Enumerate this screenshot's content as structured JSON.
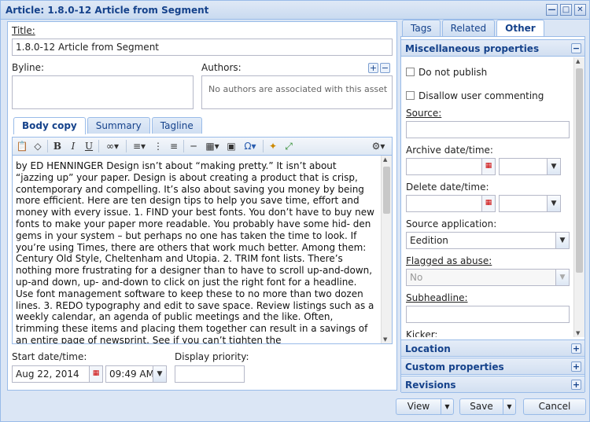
{
  "window": {
    "title": "Article: 1.8.0-12 Article from Segment"
  },
  "left": {
    "title_label": "Title:",
    "title_value": "1.8.0-12 Article from Segment",
    "byline_label": "Byline:",
    "byline_value": "",
    "authors_label": "Authors:",
    "authors_empty": "No authors are associated with this asset",
    "tabs": [
      {
        "label": "Body copy"
      },
      {
        "label": "Summary"
      },
      {
        "label": "Tagline"
      }
    ],
    "body_text": "by ED HENNINGER Design isn’t about “making pretty.” It isn’t about “jazzing up” your paper. Design is about creating a product that is crisp, contemporary and compelling. It’s also about saving you money by being more efficient. Here are ten design tips to help you save time, effort and money with every issue. 1. FIND your best fonts. You don’t have to buy new fonts to make your paper more readable. You probably have some hid- den gems in your system – but perhaps no one has taken the time to look. If you’re using Times, there are others that work much better. Among them: Century Old Style, Cheltenham and Utopia. 2. TRIM font lists. There’s nothing more frustrating for a designer than to have to scroll up-and-down, up-and down, up- and-down to click on just the right font for a headline. Use font management software to keep these to no more than two dozen lines. 3. REDO typography and edit to save space. Review listings such as a weekly calendar, an agenda of public meetings and the like. Often, trimming these items and placing them together can result in a savings of an entire page of newsprint. See if you can’t tighten the",
    "start_label": "Start date/time:",
    "start_date": "Aug 22, 2014",
    "start_time": "09:49 AM",
    "priority_label": "Display priority:",
    "priority_value": ""
  },
  "right": {
    "tabs": [
      {
        "label": "Tags"
      },
      {
        "label": "Related"
      },
      {
        "label": "Other"
      }
    ],
    "misc_header": "Miscellaneous properties",
    "do_not_publish": "Do not publish",
    "disallow_commenting": "Disallow user commenting",
    "source_label": "Source:",
    "source_value": "",
    "archive_label": "Archive date/time:",
    "delete_label": "Delete date/time:",
    "source_app_label": "Source application:",
    "source_app_value": "Eedition",
    "flagged_label": "Flagged as abuse:",
    "flagged_value": "No",
    "subheadline_label": "Subheadline:",
    "kicker_label": "Kicker:",
    "sections": [
      {
        "label": "Location"
      },
      {
        "label": "Custom properties"
      },
      {
        "label": "Revisions"
      }
    ]
  },
  "buttons": {
    "view": "View",
    "save": "Save",
    "cancel": "Cancel"
  },
  "icons": {
    "minimize": "minimize-icon",
    "maximize": "maximize-icon",
    "close": "close-icon"
  }
}
